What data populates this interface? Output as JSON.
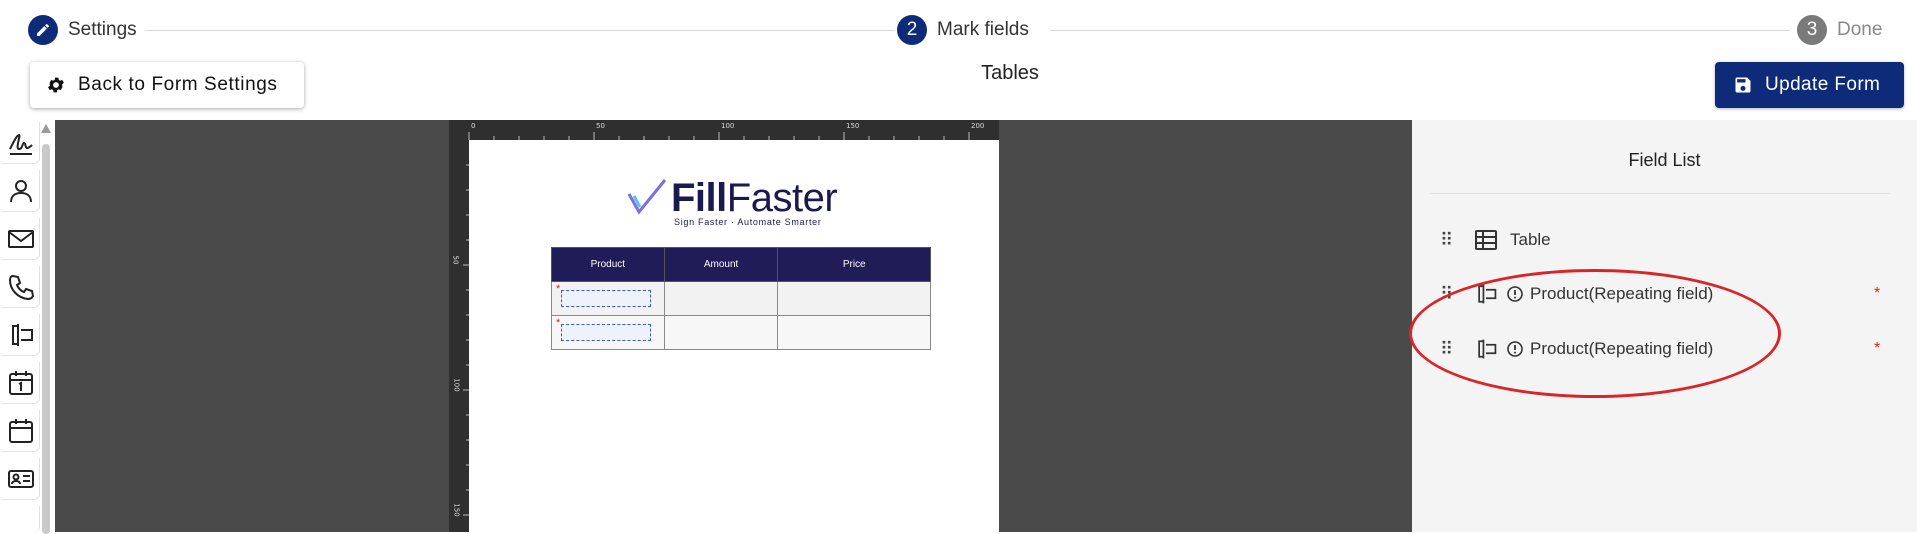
{
  "stepper": {
    "steps": [
      {
        "number": "",
        "label": "Settings"
      },
      {
        "number": "2",
        "label": "Mark fields"
      },
      {
        "number": "3",
        "label": "Done"
      }
    ]
  },
  "header": {
    "back_label": "Back to Form Settings",
    "title": "Tables",
    "update_label": "Update Form"
  },
  "ruler": {
    "top_marks": [
      "0",
      "50",
      "100",
      "150",
      "200"
    ],
    "left_marks": [
      "50",
      "100",
      "150"
    ]
  },
  "document": {
    "logo_bold": "Fill",
    "logo_light": "Faster",
    "tagline": "Sign Faster · Automate Smarter",
    "table_headers": [
      "Product",
      "Amount",
      "Price"
    ],
    "required_mark": "*"
  },
  "field_list": {
    "title": "Field List",
    "items": [
      {
        "label": "Table",
        "icon": "table-icon"
      },
      {
        "label": "Product(Repeating field)",
        "icon": "text-field-icon",
        "required": "*"
      },
      {
        "label": "Product(Repeating field)",
        "icon": "text-field-icon",
        "required": "*"
      }
    ]
  },
  "toolbar": {
    "tools": [
      "signature-icon",
      "person-icon",
      "email-icon",
      "phone-icon",
      "text-field-icon",
      "date-icon",
      "calendar-icon",
      "id-card-icon"
    ]
  },
  "colors": {
    "primary": "#0d2b78",
    "canvas": "#4a4a4a",
    "table_header": "#201c57",
    "highlight": "#d9242a"
  }
}
